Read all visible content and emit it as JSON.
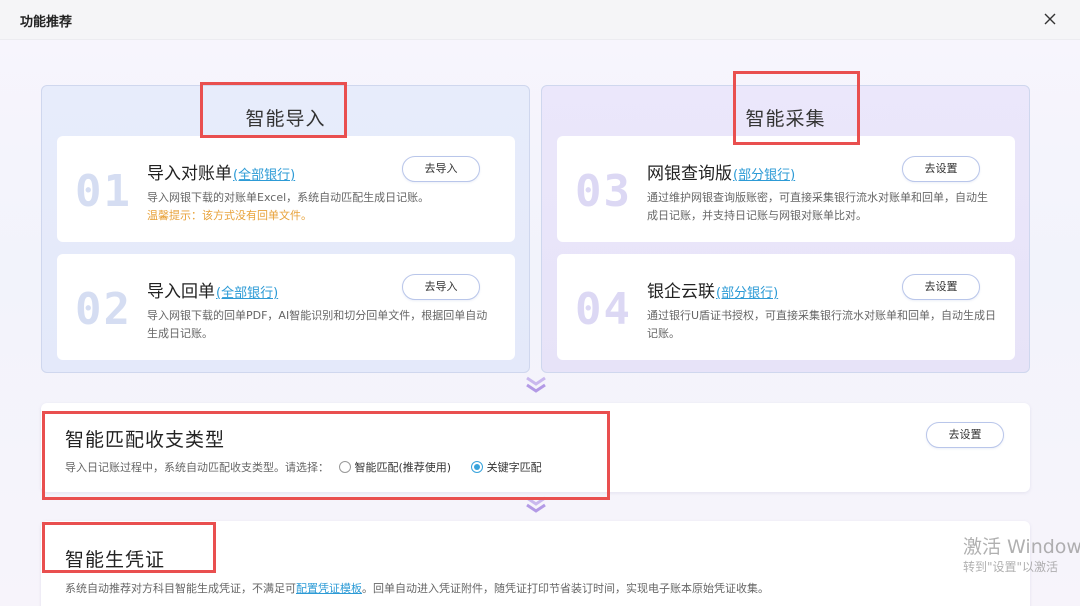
{
  "dialog": {
    "title": "功能推荐",
    "close_icon": "close-icon"
  },
  "groups": {
    "left": {
      "title": "智能导入",
      "cards": [
        {
          "number": "01",
          "title": "导入对账单",
          "link": "(全部银行)",
          "button": "去导入",
          "desc": "导入网银下载的对账单Excel，系统自动匹配生成日记账。",
          "warn": "温馨提示：该方式没有回单文件。"
        },
        {
          "number": "02",
          "title": "导入回单",
          "link": "(全部银行)",
          "button": "去导入",
          "desc": "导入网银下载的回单PDF，AI智能识别和切分回单文件，根据回单自动生成日记账。"
        }
      ]
    },
    "right": {
      "title": "智能采集",
      "cards": [
        {
          "number": "03",
          "title": "网银查询版",
          "link": "(部分银行)",
          "button": "去设置",
          "desc": "通过维护网银查询版账密，可直接采集银行流水对账单和回单，自动生成日记账，并支持日记账与网银对账单比对。"
        },
        {
          "number": "04",
          "title": "银企云联",
          "link": "(部分银行)",
          "button": "去设置",
          "desc": "通过银行U盾证书授权，可直接采集银行流水对账单和回单，自动生成日记账。"
        }
      ]
    }
  },
  "match_panel": {
    "title": "智能匹配收支类型",
    "desc": "导入日记账过程中，系统自动匹配收支类型。请选择：",
    "options": [
      {
        "label": "智能匹配(推荐使用)",
        "selected": false
      },
      {
        "label": "关键字匹配",
        "selected": true
      }
    ],
    "button": "去设置"
  },
  "voucher_panel": {
    "title": "智能生凭证",
    "desc_before": "系统自动推荐对方科目智能生成凭证，不满足可",
    "desc_link": "配置凭证模板",
    "desc_after": "。回单自动进入凭证附件，随凭证打印节省装订时间，实现电子账本原始凭证收集。"
  },
  "watermark": {
    "line1": "激活 Window",
    "line2": "转到\"设置\"以激活"
  },
  "colors": {
    "accent": "#2d9bd6",
    "warning": "#e8a23a",
    "annotation": "#e94f4f",
    "radio_on": "#38a3dc"
  }
}
